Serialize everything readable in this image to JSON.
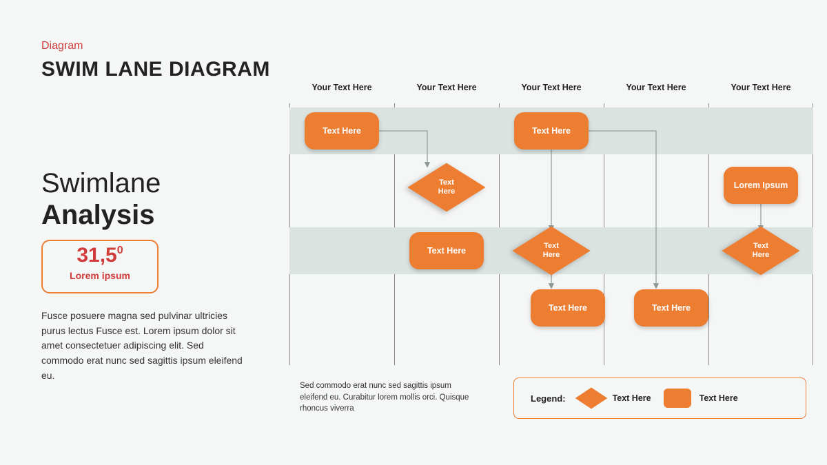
{
  "header": {
    "category": "Diagram",
    "title": "SWIM LANE DIAGRAM"
  },
  "sidebar": {
    "line1": "Swimlane",
    "line2": "Analysis",
    "metric_value": "31,5",
    "metric_exp": "0",
    "metric_caption": "Lorem ipsum",
    "body": "Fusce posuere magna sed pulvinar ultricies purus lectus Fusce est. Lorem ipsum dolor sit amet consectetuer adipiscing elit. Sed commodo erat nunc sed sagittis ipsum eleifend eu."
  },
  "columns": [
    "Your Text Here",
    "Your Text Here",
    "Your Text Here",
    "Your Text Here",
    "Your Text Here"
  ],
  "shapes": {
    "r1c1": "Text Here",
    "r1c3": "Text Here",
    "d_r2_c2": "Text\nHere",
    "r2c5": "Lorem Ipsum",
    "r3c2": "Text Here",
    "d_r3_c3": "Text\nHere",
    "d_r3_c5": "Text\nHere",
    "r4c3": "Text Here",
    "r4c4": "Text Here"
  },
  "footer_note": "Sed commodo  erat nunc sed sagittis ipsum eleifend eu. Curabitur lorem mollis orci. Quisque rhoncus viverra",
  "legend": {
    "title": "Legend:",
    "diamond_label": "Text Here",
    "rect_label": "Text Here"
  }
}
